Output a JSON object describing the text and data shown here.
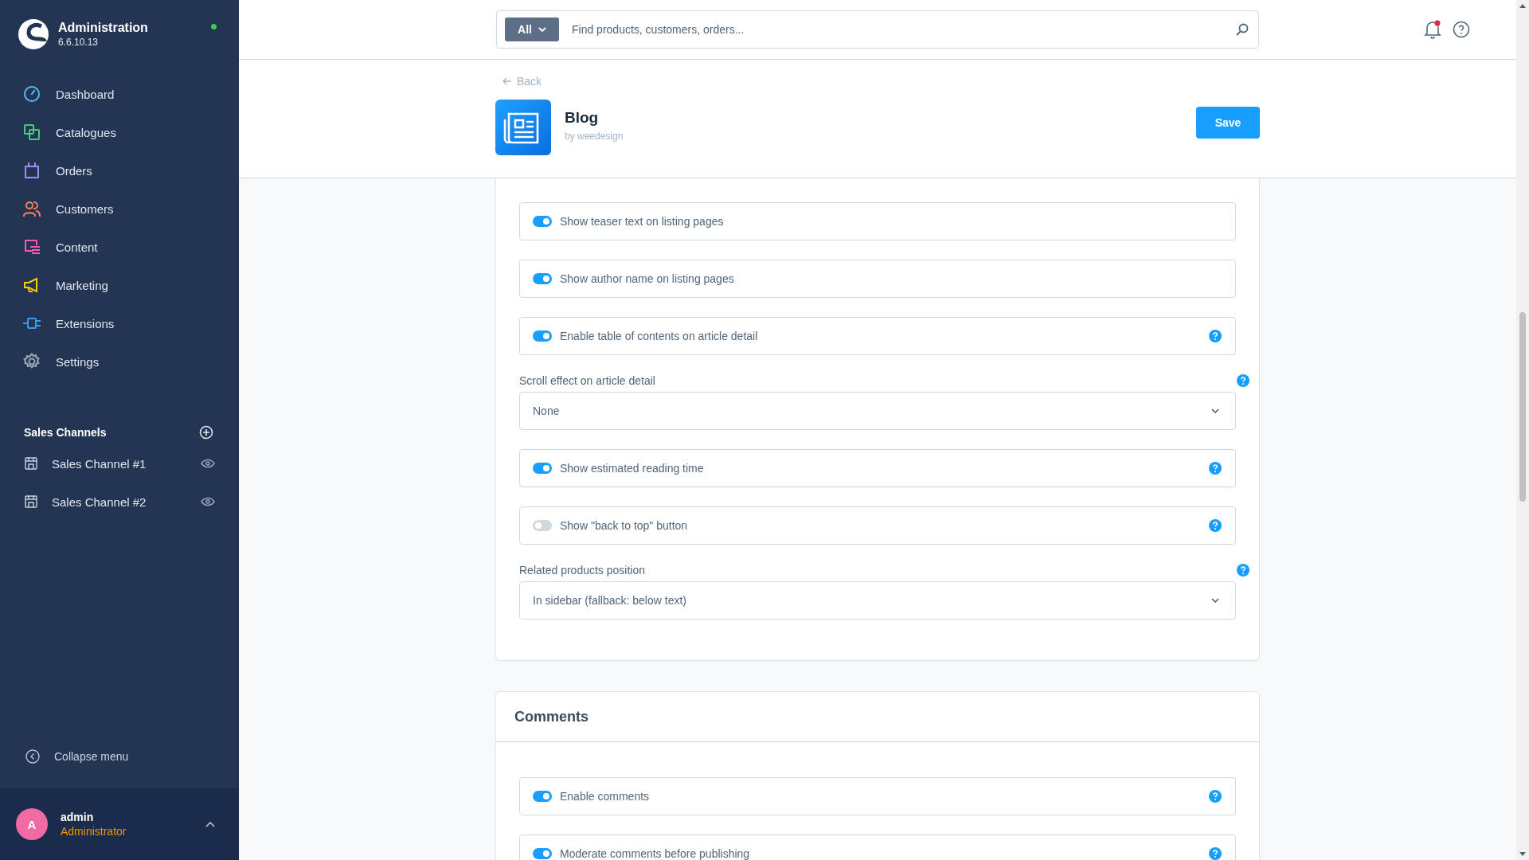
{
  "sidebar": {
    "brand": {
      "title": "Administration",
      "version": "6.6.10.13",
      "online": true
    },
    "nav": [
      {
        "label": "Dashboard",
        "color": "#4cc3f0",
        "selected": false
      },
      {
        "label": "Catalogues",
        "color": "#45c985",
        "selected": false
      },
      {
        "label": "Orders",
        "color": "#a78bf5",
        "selected": false
      },
      {
        "label": "Customers",
        "color": "#f4855c",
        "selected": false
      },
      {
        "label": "Content",
        "color": "#f35dac",
        "selected": false
      },
      {
        "label": "Marketing",
        "color": "#ffcc00",
        "selected": false
      },
      {
        "label": "Extensions",
        "color": "#2f9ff0",
        "selected": false
      },
      {
        "label": "Settings",
        "color": "#9aa8b8",
        "selected": false
      }
    ],
    "sales_channels": {
      "title": "Sales Channels",
      "items": [
        {
          "label": "Sales Channel #1"
        },
        {
          "label": "Sales Channel #2"
        }
      ]
    },
    "collapse": "Collapse menu",
    "user": {
      "initial": "A",
      "name": "admin",
      "role": "Administrator"
    }
  },
  "topbar": {
    "scope": "All",
    "placeholder": "Find products, customers, orders...",
    "notification": true
  },
  "page": {
    "back": "Back",
    "title": "Blog",
    "vendor": "by weedesign",
    "save": "Save"
  },
  "cards": [
    {
      "fields": [
        {
          "kind": "toggle",
          "label": "Show teaser text on listing pages",
          "on": true,
          "help": false
        },
        {
          "kind": "toggle",
          "label": "Show author name on listing pages",
          "on": true,
          "help": false
        },
        {
          "kind": "toggle",
          "label": "Enable table of contents on article detail",
          "on": true,
          "help": true
        },
        {
          "kind": "select",
          "label": "Scroll effect on article detail",
          "value": "None",
          "help": true
        },
        {
          "kind": "toggle",
          "label": "Show estimated reading time",
          "on": true,
          "help": true
        },
        {
          "kind": "toggle",
          "label": "Show \"back to top\" button",
          "on": false,
          "help": true
        },
        {
          "kind": "select",
          "label": "Related products position",
          "value": "In sidebar (fallback: below text)",
          "help": true
        }
      ]
    },
    {
      "title": "Comments",
      "fields": [
        {
          "kind": "toggle",
          "label": "Enable comments",
          "on": true,
          "help": true
        },
        {
          "kind": "toggle",
          "label": "Moderate comments before publishing",
          "on": true,
          "help": true
        }
      ]
    }
  ]
}
